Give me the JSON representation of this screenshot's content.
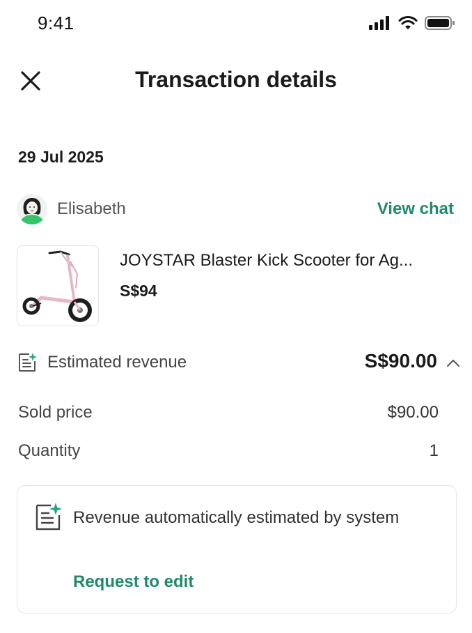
{
  "status_bar": {
    "time": "9:41"
  },
  "header": {
    "title": "Transaction details"
  },
  "transaction": {
    "date": "29 Jul 2025"
  },
  "user": {
    "name": "Elisabeth",
    "view_chat_label": "View chat"
  },
  "product": {
    "title": "JOYSTAR Blaster Kick Scooter for Ag...",
    "price": "S$94"
  },
  "revenue": {
    "label": "Estimated revenue",
    "amount": "S$90.00",
    "rows": [
      {
        "label": "Sold price",
        "value": "$90.00"
      },
      {
        "label": "Quantity",
        "value": "1"
      }
    ]
  },
  "info_card": {
    "text": "Revenue automatically estimated by system",
    "link": "Request to edit"
  },
  "colors": {
    "accent": "#1f8a6b",
    "text": "#1b1b1b",
    "muted": "#444444",
    "border": "#e6e6e6"
  }
}
